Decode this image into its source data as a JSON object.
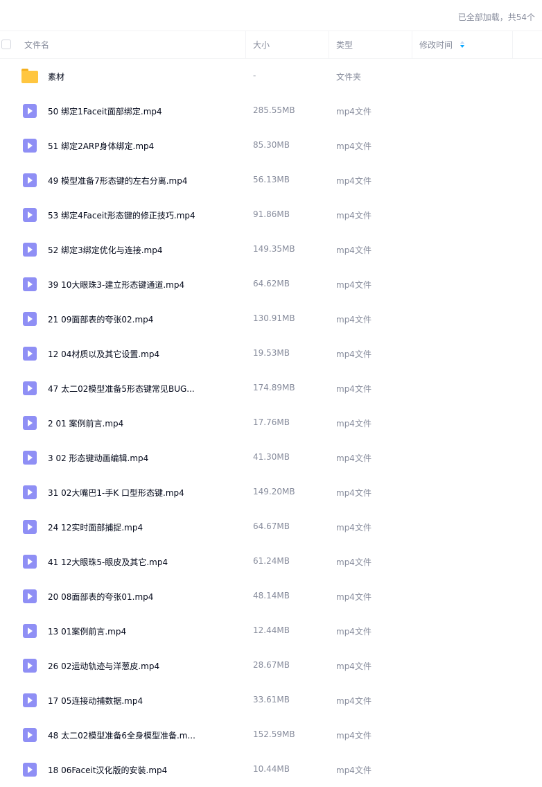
{
  "status": "已全部加载，共54个",
  "columns": {
    "name": "文件名",
    "size": "大小",
    "type": "类型",
    "modified": "修改时间"
  },
  "colors": {
    "video_icon": "#8f8ff5",
    "folder_icon": "#ffc640",
    "sort_active": "#06a7ff"
  },
  "files": [
    {
      "icon": "folder-icon",
      "name": "素材",
      "size": "-",
      "type": "文件夹"
    },
    {
      "icon": "video-file-icon",
      "name": "50 绑定1Faceit面部绑定.mp4",
      "size": "285.55MB",
      "type": "mp4文件"
    },
    {
      "icon": "video-file-icon",
      "name": "51 绑定2ARP身体绑定.mp4",
      "size": "85.30MB",
      "type": "mp4文件"
    },
    {
      "icon": "video-file-icon",
      "name": "49 模型准备7形态键的左右分离.mp4",
      "size": "56.13MB",
      "type": "mp4文件"
    },
    {
      "icon": "video-file-icon",
      "name": "53 绑定4Faceit形态键的修正技巧.mp4",
      "size": "91.86MB",
      "type": "mp4文件"
    },
    {
      "icon": "video-file-icon",
      "name": "52 绑定3绑定优化与连接.mp4",
      "size": "149.35MB",
      "type": "mp4文件"
    },
    {
      "icon": "video-file-icon",
      "name": "39 10大眼珠3-建立形态键通道.mp4",
      "size": "64.62MB",
      "type": "mp4文件"
    },
    {
      "icon": "video-file-icon",
      "name": "21 09面部表的夸张02.mp4",
      "size": "130.91MB",
      "type": "mp4文件"
    },
    {
      "icon": "video-file-icon",
      "name": "12 04材质以及其它设置.mp4",
      "size": "19.53MB",
      "type": "mp4文件"
    },
    {
      "icon": "video-file-icon",
      "name": "47 太二02模型准备5形态键常见BUG...",
      "size": "174.89MB",
      "type": "mp4文件"
    },
    {
      "icon": "video-file-icon",
      "name": "2 01 案例前言.mp4",
      "size": "17.76MB",
      "type": "mp4文件"
    },
    {
      "icon": "video-file-icon",
      "name": "3 02 形态键动画编辑.mp4",
      "size": "41.30MB",
      "type": "mp4文件"
    },
    {
      "icon": "video-file-icon",
      "name": "31 02大嘴巴1-手K 口型形态键.mp4",
      "size": "149.20MB",
      "type": "mp4文件"
    },
    {
      "icon": "video-file-icon",
      "name": "24 12实时面部捕捉.mp4",
      "size": "64.67MB",
      "type": "mp4文件"
    },
    {
      "icon": "video-file-icon",
      "name": "41 12大眼珠5-眼皮及其它.mp4",
      "size": "61.24MB",
      "type": "mp4文件"
    },
    {
      "icon": "video-file-icon",
      "name": "20 08面部表的夸张01.mp4",
      "size": "48.14MB",
      "type": "mp4文件"
    },
    {
      "icon": "video-file-icon",
      "name": "13 01案例前言.mp4",
      "size": "12.44MB",
      "type": "mp4文件"
    },
    {
      "icon": "video-file-icon",
      "name": "26 02运动轨迹与洋葱皮.mp4",
      "size": "28.67MB",
      "type": "mp4文件"
    },
    {
      "icon": "video-file-icon",
      "name": "17 05连接动捕数据.mp4",
      "size": "33.61MB",
      "type": "mp4文件"
    },
    {
      "icon": "video-file-icon",
      "name": "48 太二02模型准备6全身模型准备.m...",
      "size": "152.59MB",
      "type": "mp4文件"
    },
    {
      "icon": "video-file-icon",
      "name": "18 06Faceit汉化版的安装.mp4",
      "size": "10.44MB",
      "type": "mp4文件"
    }
  ]
}
